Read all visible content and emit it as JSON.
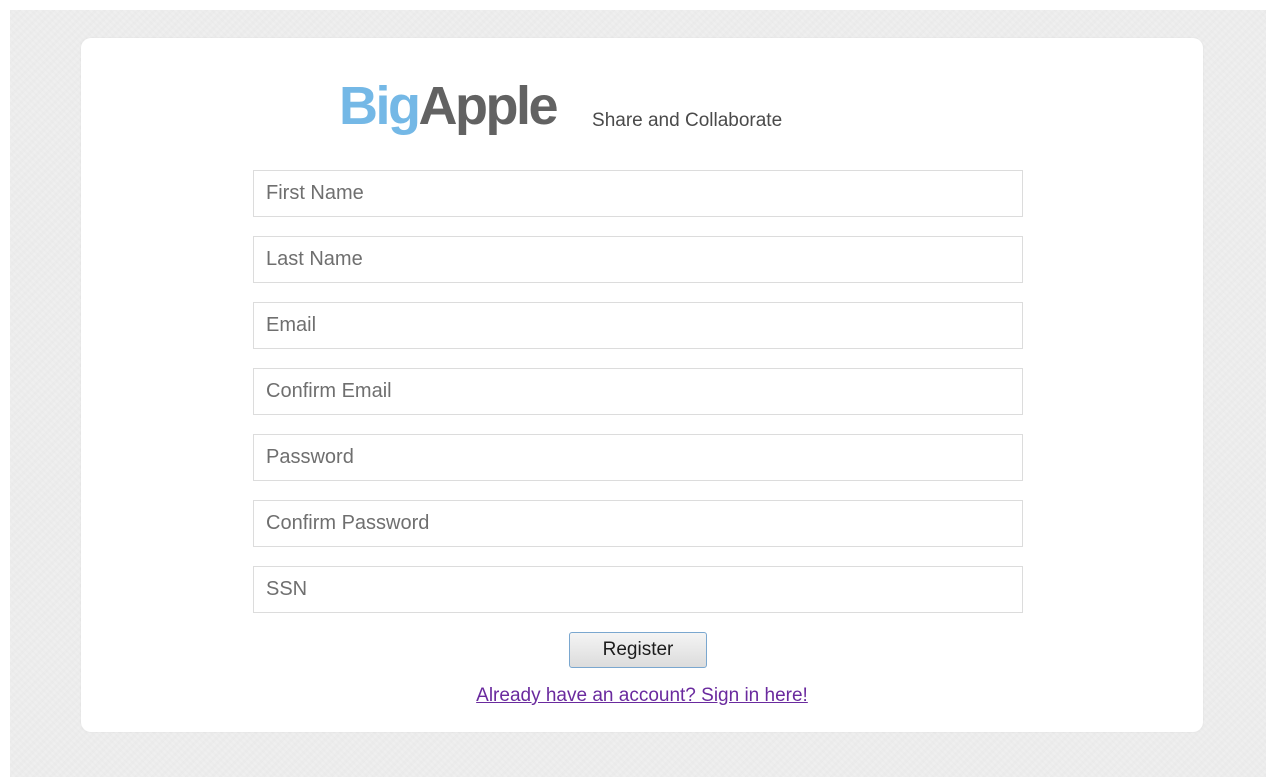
{
  "brand": {
    "logo_part1": "Big",
    "logo_part2": "Apple",
    "tagline": "Share and Collaborate",
    "colors": {
      "logo_part1": "#74b8e6",
      "logo_part2": "#626262"
    }
  },
  "form": {
    "fields": [
      {
        "placeholder": "First Name",
        "value": ""
      },
      {
        "placeholder": "Last Name",
        "value": ""
      },
      {
        "placeholder": "Email",
        "value": ""
      },
      {
        "placeholder": "Confirm Email",
        "value": ""
      },
      {
        "placeholder": "Password",
        "value": ""
      },
      {
        "placeholder": "Confirm Password",
        "value": ""
      },
      {
        "placeholder": "SSN",
        "value": ""
      }
    ],
    "register_label": "Register",
    "signin_link": "Already have an account? Sign in here!",
    "link_color": "#6a2a9e"
  }
}
